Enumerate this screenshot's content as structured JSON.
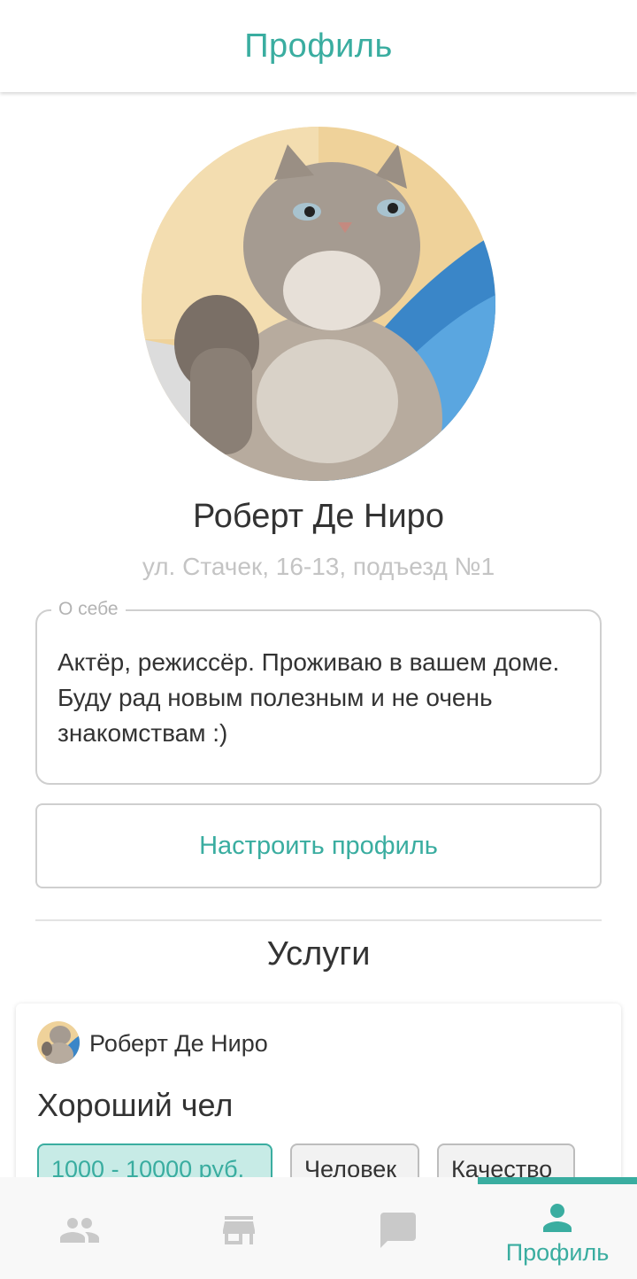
{
  "topbar": {
    "title": "Профиль"
  },
  "profile": {
    "name": "Роберт Де Ниро",
    "address": "ул. Стачек, 16-13, подъезд №1",
    "about_label": "О себе",
    "about_text": "Актёр, режиссёр. Проживаю в вашем доме. Буду рад новым полезным и не очень знакомствам :)",
    "settings_button": "Настроить профиль"
  },
  "services": {
    "title": "Услуги",
    "card": {
      "author": "Роберт Де Ниро",
      "title": "Хороший чел",
      "tags": [
        "1000 - 10000 руб.",
        "Человек",
        "Качество"
      ]
    }
  },
  "bottom_nav": {
    "items": [
      {
        "icon": "people-icon",
        "label": ""
      },
      {
        "icon": "store-icon",
        "label": ""
      },
      {
        "icon": "chat-icon",
        "label": ""
      },
      {
        "icon": "person-icon",
        "label": "Профиль",
        "active": true
      }
    ]
  },
  "colors": {
    "accent": "#3aada0",
    "muted": "#c4c4c4",
    "icon_inactive": "#c9c9c9"
  }
}
